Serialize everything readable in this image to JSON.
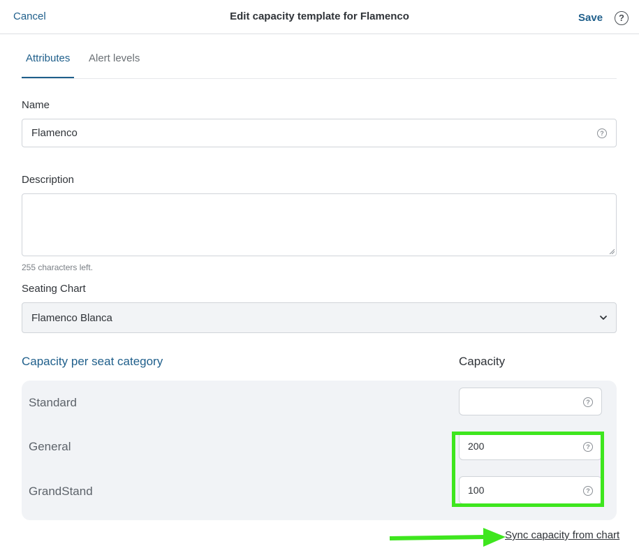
{
  "header": {
    "cancel_label": "Cancel",
    "title": "Edit capacity template for Flamenco",
    "save_label": "Save",
    "help_icon": "question-circle-icon"
  },
  "tabs": [
    {
      "label": "Attributes",
      "active": true
    },
    {
      "label": "Alert levels",
      "active": false
    }
  ],
  "form": {
    "name": {
      "label": "Name",
      "value": "Flamenco",
      "help_icon": "question-circle-icon"
    },
    "description": {
      "label": "Description",
      "value": "",
      "chars_left": "255 characters left."
    },
    "seating_chart": {
      "label": "Seating Chart",
      "selected": "Flamenco Blanca",
      "icon": "chevron-down-icon"
    }
  },
  "capacity": {
    "section_title": "Capacity per seat category",
    "column_header": "Capacity",
    "rows": [
      {
        "category": "Standard",
        "value": ""
      },
      {
        "category": "General",
        "value": "200"
      },
      {
        "category": "GrandStand",
        "value": "100"
      }
    ]
  },
  "sync_link": "Sync capacity from chart",
  "colors": {
    "accent": "#1f5f8b",
    "highlight": "#3ee61e"
  }
}
